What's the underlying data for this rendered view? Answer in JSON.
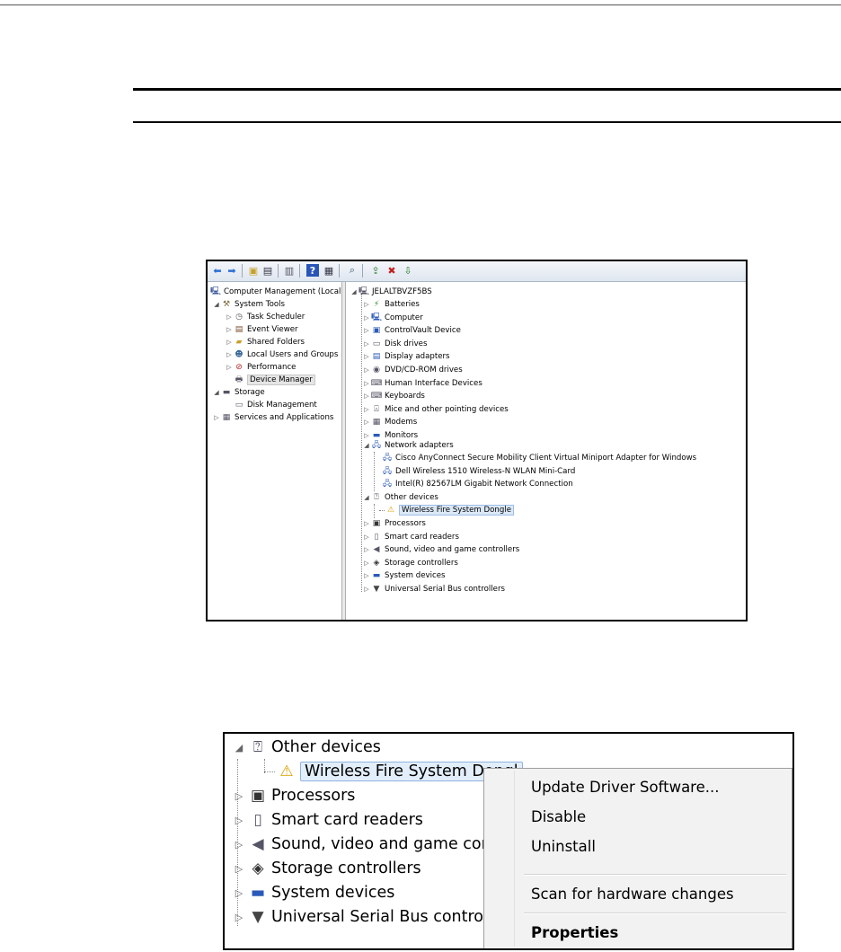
{
  "cm_window": {
    "toolbar_icons": [
      "back-arrow-icon",
      "forward-arrow-icon",
      "up-folder-icon",
      "show-hide-tree-icon",
      "export-list-icon",
      "help-icon",
      "action-pane-icon",
      "scan-hardware-icon",
      "update-driver-icon",
      "uninstall-device-icon",
      "enable-device-icon"
    ],
    "left_tree": {
      "root": "Computer Management (Local",
      "system_tools": "System Tools",
      "task_scheduler": "Task Scheduler",
      "event_viewer": "Event Viewer",
      "shared_folders": "Shared Folders",
      "local_users": "Local Users and Groups",
      "performance": "Performance",
      "device_manager": "Device Manager",
      "storage": "Storage",
      "disk_management": "Disk Management",
      "services_apps": "Services and Applications"
    },
    "device_tree": {
      "computer_name": "JELALTBVZF5BS",
      "categories": [
        "Batteries",
        "Computer",
        "ControlVault Device",
        "Disk drives",
        "Display adapters",
        "DVD/CD-ROM drives",
        "Human Interface Devices",
        "Keyboards",
        "Mice and other pointing devices",
        "Modems",
        "Monitors"
      ],
      "network_adapters": "Network adapters",
      "network_children": [
        "Cisco AnyConnect Secure Mobility Client Virtual Miniport Adapter for Windows",
        "Dell Wireless 1510 Wireless-N WLAN Mini-Card",
        "Intel(R) 82567LM Gigabit Network Connection"
      ],
      "other_devices": "Other devices",
      "other_child": "Wireless Fire System Dongle",
      "after": [
        "Processors",
        "Smart card readers",
        "Sound, video and game controllers",
        "Storage controllers",
        "System devices",
        "Universal Serial Bus controllers"
      ]
    }
  },
  "zoom_window": {
    "other_devices": "Other devices",
    "dongle": "Wireless Fire System Dongl",
    "rows": [
      "Processors",
      "Smart card readers",
      "Sound, video and game contr",
      "Storage controllers",
      "System devices",
      "Universal Serial Bus controllers"
    ],
    "context_menu": {
      "update_driver": "Update Driver Software...",
      "disable": "Disable",
      "uninstall": "Uninstall",
      "scan": "Scan for hardware changes",
      "properties": "Properties"
    }
  }
}
